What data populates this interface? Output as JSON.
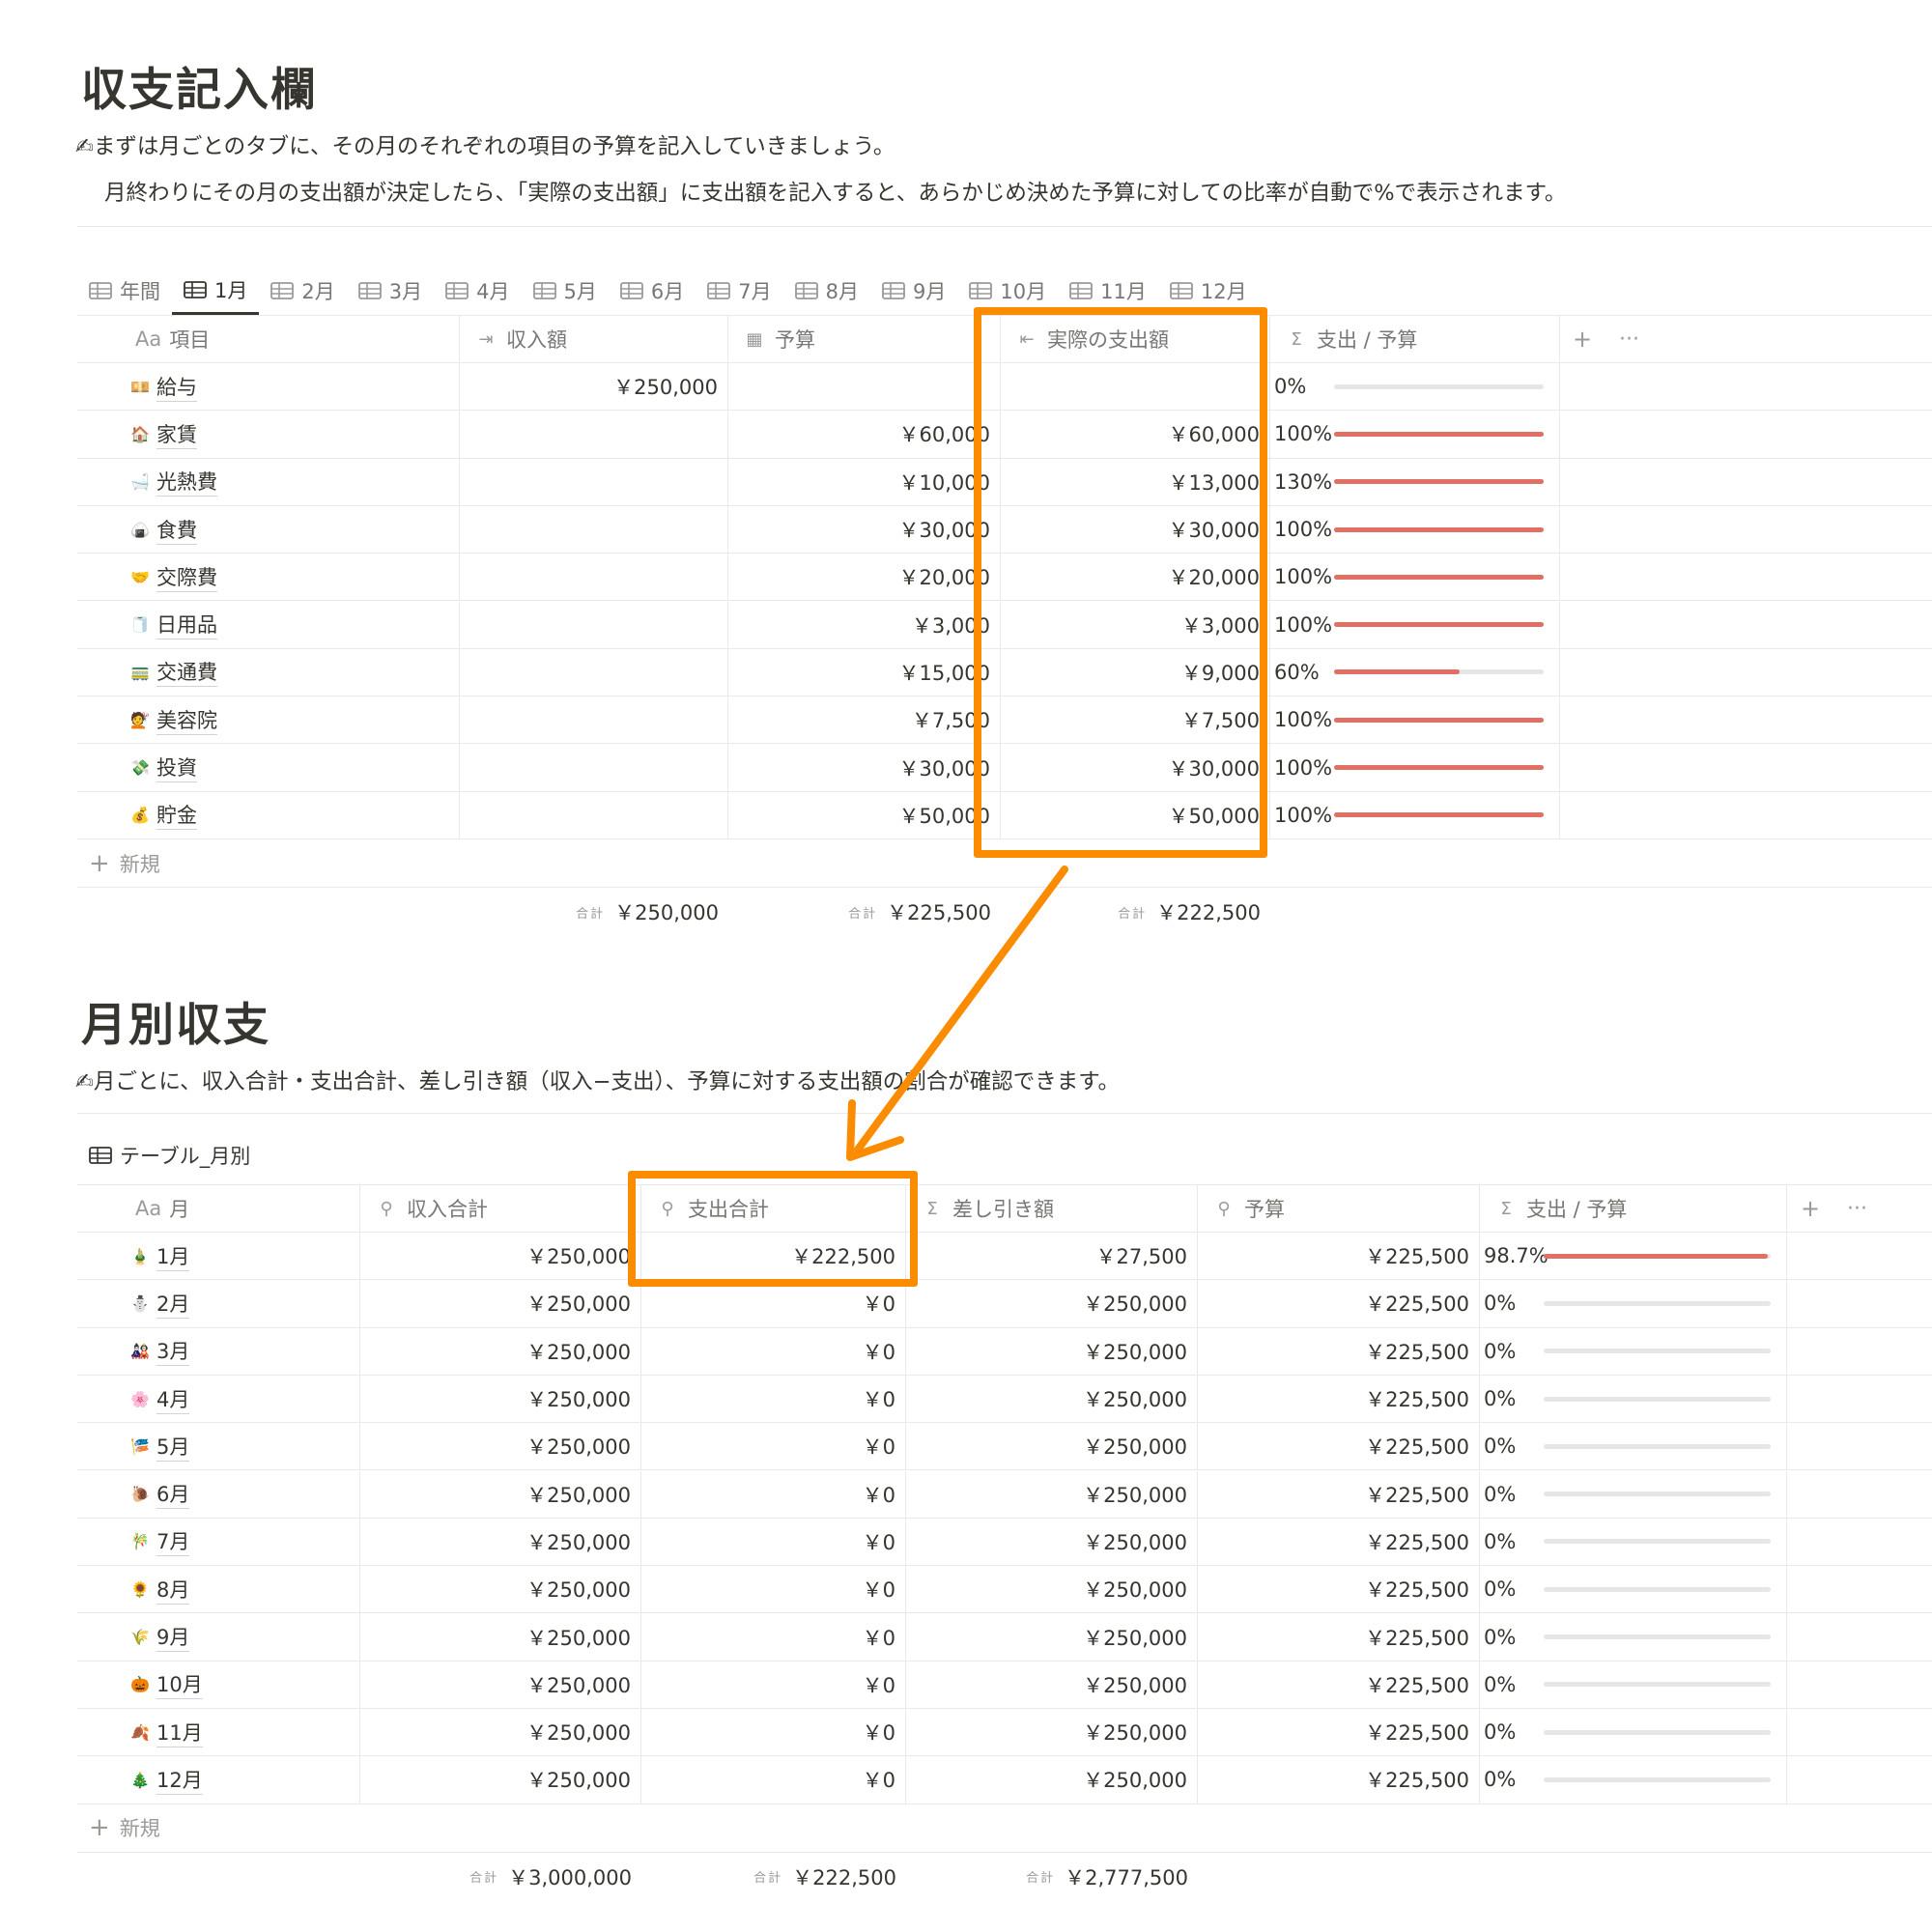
{
  "section1": {
    "title": "収支記入欄",
    "para1": "✍まずは月ごとのタブに、その月のそれぞれの項目の予算を記入していきましょう。",
    "para2": "月終わりにその月の支出額が決定したら、「実際の支出額」に支出額を記入すると、あらかじめ決めた予算に対しての比率が自動で%で表示されます。"
  },
  "tabs": [
    "年間",
    "1月",
    "2月",
    "3月",
    "4月",
    "5月",
    "6月",
    "7月",
    "8月",
    "9月",
    "10月",
    "11月",
    "12月"
  ],
  "active_tab": "1月",
  "table1": {
    "headers": {
      "name": {
        "prefix": "Aa",
        "label": "項目"
      },
      "income": {
        "label": "収入額",
        "icon": "sign-in-icon"
      },
      "budget": {
        "label": "予算",
        "icon": "calculator-icon"
      },
      "actual": {
        "label": "実際の支出額",
        "icon": "sign-out-icon"
      },
      "ratio": {
        "label": "支出 / 予算",
        "icon": "sigma-icon"
      }
    },
    "add_column": "+",
    "more": "···",
    "rows": [
      {
        "emoji": "💴",
        "name": "給与",
        "income": "￥250,000",
        "budget": "",
        "actual": "",
        "pct": "0%",
        "fill": 0
      },
      {
        "emoji": "🏠",
        "name": "家賃",
        "income": "",
        "budget": "￥60,000",
        "actual": "￥60,000",
        "pct": "100%",
        "fill": 1.0
      },
      {
        "emoji": "🛁",
        "name": "光熱費",
        "income": "",
        "budget": "￥10,000",
        "actual": "￥13,000",
        "pct": "130%",
        "fill": 1.0
      },
      {
        "emoji": "🍙",
        "name": "食費",
        "income": "",
        "budget": "￥30,000",
        "actual": "￥30,000",
        "pct": "100%",
        "fill": 1.0
      },
      {
        "emoji": "🤝",
        "name": "交際費",
        "income": "",
        "budget": "￥20,000",
        "actual": "￥20,000",
        "pct": "100%",
        "fill": 1.0
      },
      {
        "emoji": "🧻",
        "name": "日用品",
        "income": "",
        "budget": "￥3,000",
        "actual": "￥3,000",
        "pct": "100%",
        "fill": 1.0
      },
      {
        "emoji": "🚃",
        "name": "交通費",
        "income": "",
        "budget": "￥15,000",
        "actual": "￥9,000",
        "pct": "60%",
        "fill": 0.6
      },
      {
        "emoji": "💇",
        "name": "美容院",
        "income": "",
        "budget": "￥7,500",
        "actual": "￥7,500",
        "pct": "100%",
        "fill": 1.0
      },
      {
        "emoji": "💸",
        "name": "投資",
        "income": "",
        "budget": "￥30,000",
        "actual": "￥30,000",
        "pct": "100%",
        "fill": 1.0
      },
      {
        "emoji": "💰",
        "name": "貯金",
        "income": "",
        "budget": "￥50,000",
        "actual": "￥50,000",
        "pct": "100%",
        "fill": 1.0
      }
    ],
    "new_label": "新規",
    "sum_label": "合計",
    "totals": {
      "income": "￥250,000",
      "budget": "￥225,500",
      "actual": "￥222,500"
    }
  },
  "section2": {
    "title": "月別収支",
    "para": "✍月ごとに、収入合計・支出合計、差し引き額（収入−支出）、予算に対する支出額の割合が確認できます。",
    "db_title": "テーブル_月別"
  },
  "table2": {
    "headers": {
      "month": {
        "prefix": "Aa",
        "label": "月"
      },
      "income": {
        "label": "収入合計",
        "icon": "search-icon"
      },
      "expense": {
        "label": "支出合計",
        "icon": "search-icon"
      },
      "diff": {
        "label": "差し引き額",
        "icon": "sigma-icon"
      },
      "budget": {
        "label": "予算",
        "icon": "search-icon"
      },
      "ratio": {
        "label": "支出 / 予算",
        "icon": "sigma-icon"
      }
    },
    "add_column": "+",
    "more": "···",
    "rows": [
      {
        "emoji": "🎍",
        "month": "1月",
        "income": "￥250,000",
        "expense": "￥222,500",
        "diff": "￥27,500",
        "budget": "￥225,500",
        "pct": "98.7%",
        "fill": 0.987
      },
      {
        "emoji": "⛄",
        "month": "2月",
        "income": "￥250,000",
        "expense": "￥0",
        "diff": "￥250,000",
        "budget": "￥225,500",
        "pct": "0%",
        "fill": 0
      },
      {
        "emoji": "🎎",
        "month": "3月",
        "income": "￥250,000",
        "expense": "￥0",
        "diff": "￥250,000",
        "budget": "￥225,500",
        "pct": "0%",
        "fill": 0
      },
      {
        "emoji": "🌸",
        "month": "4月",
        "income": "￥250,000",
        "expense": "￥0",
        "diff": "￥250,000",
        "budget": "￥225,500",
        "pct": "0%",
        "fill": 0
      },
      {
        "emoji": "🎏",
        "month": "5月",
        "income": "￥250,000",
        "expense": "￥0",
        "diff": "￥250,000",
        "budget": "￥225,500",
        "pct": "0%",
        "fill": 0
      },
      {
        "emoji": "🐌",
        "month": "6月",
        "income": "￥250,000",
        "expense": "￥0",
        "diff": "￥250,000",
        "budget": "￥225,500",
        "pct": "0%",
        "fill": 0
      },
      {
        "emoji": "🎋",
        "month": "7月",
        "income": "￥250,000",
        "expense": "￥0",
        "diff": "￥250,000",
        "budget": "￥225,500",
        "pct": "0%",
        "fill": 0
      },
      {
        "emoji": "🌻",
        "month": "8月",
        "income": "￥250,000",
        "expense": "￥0",
        "diff": "￥250,000",
        "budget": "￥225,500",
        "pct": "0%",
        "fill": 0
      },
      {
        "emoji": "🌾",
        "month": "9月",
        "income": "￥250,000",
        "expense": "￥0",
        "diff": "￥250,000",
        "budget": "￥225,500",
        "pct": "0%",
        "fill": 0
      },
      {
        "emoji": "🎃",
        "month": "10月",
        "income": "￥250,000",
        "expense": "￥0",
        "diff": "￥250,000",
        "budget": "￥225,500",
        "pct": "0%",
        "fill": 0
      },
      {
        "emoji": "🍂",
        "month": "11月",
        "income": "￥250,000",
        "expense": "￥0",
        "diff": "￥250,000",
        "budget": "￥225,500",
        "pct": "0%",
        "fill": 0
      },
      {
        "emoji": "🎄",
        "month": "12月",
        "income": "￥250,000",
        "expense": "￥0",
        "diff": "￥250,000",
        "budget": "￥225,500",
        "pct": "0%",
        "fill": 0
      }
    ],
    "new_label": "新規",
    "sum_label": "合計",
    "totals": {
      "income": "￥3,000,000",
      "expense": "￥222,500",
      "diff": "￥2,777,500"
    }
  },
  "colors": {
    "highlight": "#fb8c00",
    "bar_fill": "#e16f64",
    "bar_track": "#e6e6e4"
  }
}
